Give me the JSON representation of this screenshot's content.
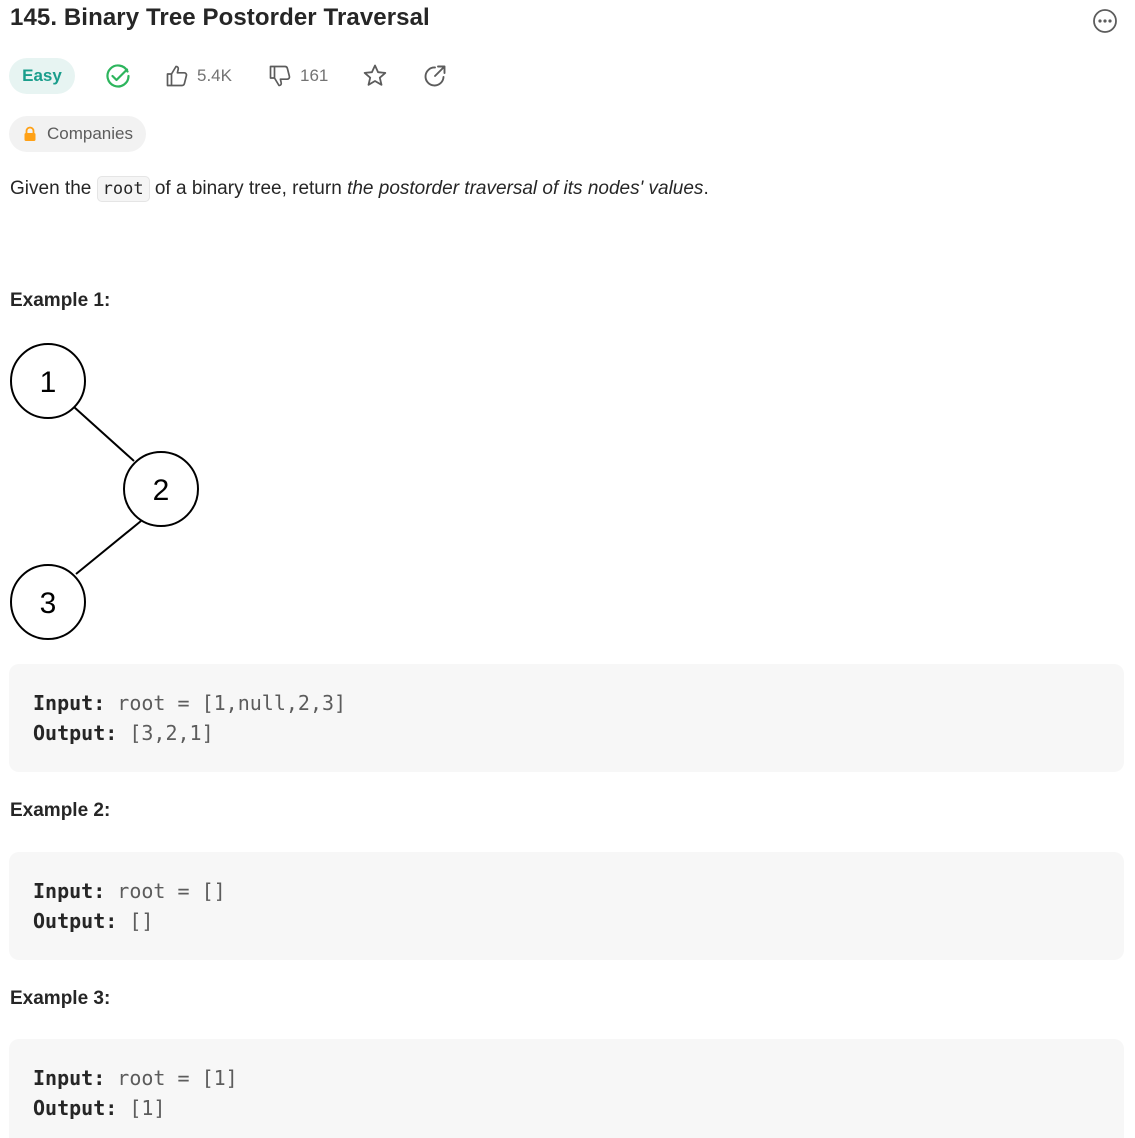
{
  "problem": {
    "title": "145. Binary Tree Postorder Traversal",
    "difficulty": "Easy",
    "likes": "5.4K",
    "dislikes": "161",
    "companies_label": "Companies"
  },
  "icons": {
    "more": "more-options-icon",
    "solved": "solved-check-icon",
    "like": "thumbs-up-icon",
    "dislike": "thumbs-down-icon",
    "favorite": "star-icon",
    "share": "share-icon",
    "lock": "lock-icon"
  },
  "colors": {
    "easy_text": "#1a9e8c",
    "easy_bg": "#e7f4f2",
    "solved": "#2db55d",
    "lock": "#ffa116"
  },
  "description": {
    "prefix": "Given the",
    "code": "root",
    "middle": "of a binary tree, return",
    "italic": "the postorder traversal of its nodes' values",
    "suffix": "."
  },
  "examples": [
    {
      "heading": "Example 1:",
      "input_label": "Input:",
      "input_value": "root = [1,null,2,3]",
      "output_label": "Output:",
      "output_value": "[3,2,1]"
    },
    {
      "heading": "Example 2:",
      "input_label": "Input:",
      "input_value": "root = []",
      "output_label": "Output:",
      "output_value": "[]"
    },
    {
      "heading": "Example 3:",
      "input_label": "Input:",
      "input_value": "root = [1]",
      "output_label": "Output:",
      "output_value": "[1]"
    }
  ],
  "tree": {
    "nodes": [
      "1",
      "2",
      "3"
    ]
  }
}
